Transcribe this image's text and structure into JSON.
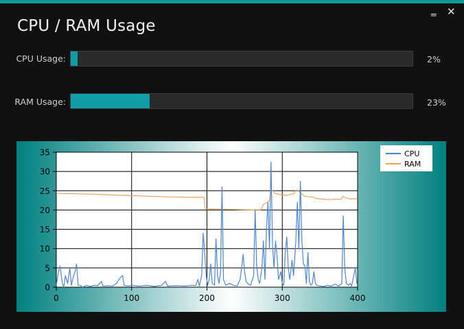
{
  "window": {
    "title": "CPU / RAM Usage",
    "minimize_glyph": "‗",
    "close_glyph": "✕",
    "accent": "#0b9a9a"
  },
  "cpu": {
    "label": "CPU Usage:",
    "percent_text": "2%",
    "fraction": 0.02
  },
  "ram": {
    "label": "RAM Usage:",
    "percent_text": "23%",
    "fraction": 0.23
  },
  "chart_data": {
    "type": "line",
    "xlim": [
      0,
      400
    ],
    "ylim": [
      0,
      35
    ],
    "x_ticks": [
      "0",
      "100",
      "200",
      "300",
      "400"
    ],
    "y_ticks": [
      "0",
      "5",
      "10",
      "15",
      "20",
      "25",
      "30",
      "35"
    ],
    "grid": true,
    "legend": "top-right",
    "series": [
      {
        "name": "CPU",
        "color": "#4a86d6",
        "points": [
          [
            0,
            0.5
          ],
          [
            3,
            4
          ],
          [
            5,
            5.5
          ],
          [
            8,
            1
          ],
          [
            10,
            0
          ],
          [
            12,
            3
          ],
          [
            15,
            1
          ],
          [
            18,
            5
          ],
          [
            20,
            0.5
          ],
          [
            23,
            3
          ],
          [
            25,
            4
          ],
          [
            27,
            6
          ],
          [
            29,
            0.5
          ],
          [
            32,
            0.5
          ],
          [
            35,
            0
          ],
          [
            40,
            0.5
          ],
          [
            45,
            0.2
          ],
          [
            50,
            0.5
          ],
          [
            55,
            0.4
          ],
          [
            60,
            1.5
          ],
          [
            62,
            0.3
          ],
          [
            70,
            0.4
          ],
          [
            75,
            0.3
          ],
          [
            80,
            1
          ],
          [
            85,
            2.5
          ],
          [
            88,
            3
          ],
          [
            90,
            0.5
          ],
          [
            95,
            0.3
          ],
          [
            100,
            0.5
          ],
          [
            110,
            0.3
          ],
          [
            120,
            0.5
          ],
          [
            130,
            0.2
          ],
          [
            140,
            0.5
          ],
          [
            145,
            1.5
          ],
          [
            148,
            0.3
          ],
          [
            160,
            0.4
          ],
          [
            170,
            0.3
          ],
          [
            180,
            0.5
          ],
          [
            185,
            0.4
          ],
          [
            188,
            2
          ],
          [
            190,
            0.3
          ],
          [
            193,
            3
          ],
          [
            195,
            14
          ],
          [
            197,
            9
          ],
          [
            199,
            3
          ],
          [
            201,
            0.5
          ],
          [
            203,
            2
          ],
          [
            205,
            6
          ],
          [
            207,
            1
          ],
          [
            210,
            0.5
          ],
          [
            212,
            12.5
          ],
          [
            214,
            3
          ],
          [
            216,
            1
          ],
          [
            218,
            4
          ],
          [
            220,
            26
          ],
          [
            222,
            2
          ],
          [
            225,
            0.5
          ],
          [
            230,
            1
          ],
          [
            235,
            0.5
          ],
          [
            240,
            0.3
          ],
          [
            244,
            2
          ],
          [
            246,
            5
          ],
          [
            248,
            8.5
          ],
          [
            250,
            4
          ],
          [
            252,
            1.5
          ],
          [
            255,
            0.8
          ],
          [
            258,
            0.5
          ],
          [
            262,
            3
          ],
          [
            264,
            20
          ],
          [
            266,
            6
          ],
          [
            268,
            2
          ],
          [
            270,
            1
          ],
          [
            273,
            5
          ],
          [
            275,
            12
          ],
          [
            277,
            2
          ],
          [
            279,
            15
          ],
          [
            281,
            22
          ],
          [
            283,
            10
          ],
          [
            285,
            32.5
          ],
          [
            287,
            11
          ],
          [
            289,
            5
          ],
          [
            291,
            12
          ],
          [
            293,
            8
          ],
          [
            295,
            2
          ],
          [
            298,
            4
          ],
          [
            300,
            1
          ],
          [
            302,
            0.5
          ],
          [
            304,
            9
          ],
          [
            306,
            13
          ],
          [
            308,
            5
          ],
          [
            310,
            2
          ],
          [
            313,
            7
          ],
          [
            315,
            3
          ],
          [
            318,
            12
          ],
          [
            320,
            22
          ],
          [
            322,
            10
          ],
          [
            324,
            27.5
          ],
          [
            326,
            12
          ],
          [
            328,
            6
          ],
          [
            330,
            5.5
          ],
          [
            332,
            1
          ],
          [
            334,
            9
          ],
          [
            336,
            1.5
          ],
          [
            338,
            0.5
          ],
          [
            340,
            1
          ],
          [
            342,
            4
          ],
          [
            344,
            1
          ],
          [
            346,
            0.5
          ],
          [
            350,
            0.3
          ],
          [
            355,
            0.2
          ],
          [
            360,
            0.5
          ],
          [
            365,
            0.3
          ],
          [
            370,
            0.8
          ],
          [
            375,
            0.3
          ],
          [
            379,
            1
          ],
          [
            381,
            18.5
          ],
          [
            383,
            5
          ],
          [
            385,
            1
          ],
          [
            388,
            0.5
          ],
          [
            390,
            1
          ],
          [
            392,
            0.3
          ],
          [
            395,
            3
          ],
          [
            397,
            5
          ],
          [
            399,
            1
          ],
          [
            400,
            0.8
          ]
        ]
      },
      {
        "name": "RAM",
        "color": "#f0a25a",
        "points": [
          [
            0,
            24.3
          ],
          [
            30,
            24.2
          ],
          [
            60,
            24.0
          ],
          [
            90,
            23.8
          ],
          [
            120,
            23.6
          ],
          [
            150,
            23.4
          ],
          [
            180,
            23.3
          ],
          [
            196,
            23.3
          ],
          [
            197,
            22
          ],
          [
            198,
            20.3
          ],
          [
            230,
            20.2
          ],
          [
            260,
            20.0
          ],
          [
            272,
            20.1
          ],
          [
            275,
            21.5
          ],
          [
            280,
            22
          ],
          [
            283,
            22.5
          ],
          [
            285,
            25
          ],
          [
            287,
            25.2
          ],
          [
            289,
            24.5
          ],
          [
            292,
            24.2
          ],
          [
            297,
            24.0
          ],
          [
            305,
            23.8
          ],
          [
            315,
            24.2
          ],
          [
            318,
            25
          ],
          [
            320,
            25.2
          ],
          [
            324,
            24.5
          ],
          [
            330,
            23.5
          ],
          [
            340,
            23.4
          ],
          [
            345,
            23.0
          ],
          [
            355,
            22.8
          ],
          [
            360,
            22.7
          ],
          [
            370,
            22.8
          ],
          [
            378,
            22.8
          ],
          [
            381,
            23.6
          ],
          [
            384,
            23.2
          ],
          [
            390,
            22.9
          ],
          [
            400,
            22.9
          ]
        ]
      }
    ]
  }
}
